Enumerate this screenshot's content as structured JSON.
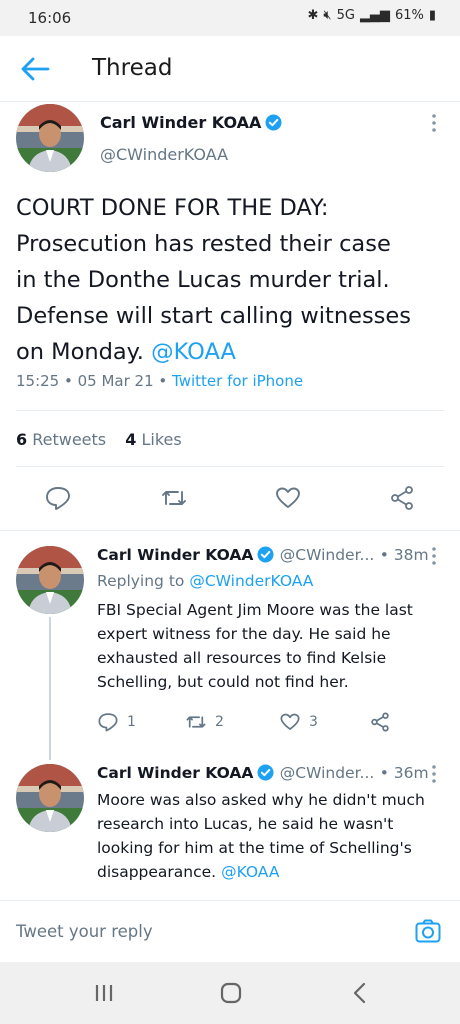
{
  "status": {
    "time": "16:06",
    "network": "5G",
    "battery": "61%"
  },
  "header": {
    "title": "Thread"
  },
  "main_tweet": {
    "author": "Carl Winder KOAA",
    "handle": "@CWinderKOAA",
    "text_lines": [
      "COURT DONE FOR THE DAY:",
      "Prosecution has rested their case",
      "in the Donthe Lucas murder trial.",
      "Defense will start calling witnesses"
    ],
    "text_last": "on Monday.",
    "mention": "@KOAA",
    "time": "15:25",
    "date": "05 Mar 21",
    "source": "Twitter for iPhone",
    "retweets_count": "6",
    "retweets_label": "Retweets",
    "likes_count": "4",
    "likes_label": "Likes"
  },
  "replies": [
    {
      "author": "Carl Winder KOAA",
      "handle": "@CWinder...",
      "age": "38m",
      "replying_to_label": "Replying to",
      "replying_to": "@CWinderKOAA",
      "text_lines": [
        "FBI Special Agent Jim Moore was the last",
        "expert witness for the day. He said he",
        "exhausted all resources to find Kelsie",
        "Schelling, but could not find her."
      ],
      "reply_count": "1",
      "retweet_count": "2",
      "like_count": "3"
    },
    {
      "author": "Carl Winder KOAA",
      "handle": "@CWinder...",
      "age": "36m",
      "text_lines": [
        "Moore was also asked why he didn't much",
        "research into Lucas, he said he wasn't",
        "looking for him at the time of Schelling's"
      ],
      "text_last": "disappearance.",
      "mention": "@KOAA"
    }
  ],
  "composer": {
    "placeholder": "Tweet your reply"
  },
  "icons": {
    "back": "arrow-left-icon",
    "verified": "verified-badge-icon",
    "more": "more-vertical-icon",
    "reply": "comment-icon",
    "retweet": "retweet-icon",
    "like": "heart-icon",
    "share": "share-icon",
    "camera": "camera-icon",
    "nav_recent": "recent-apps-icon",
    "nav_home": "home-icon",
    "nav_back": "back-icon"
  },
  "colors": {
    "accent": "#1da1f2",
    "text": "#141823",
    "secondary": "#657786"
  }
}
